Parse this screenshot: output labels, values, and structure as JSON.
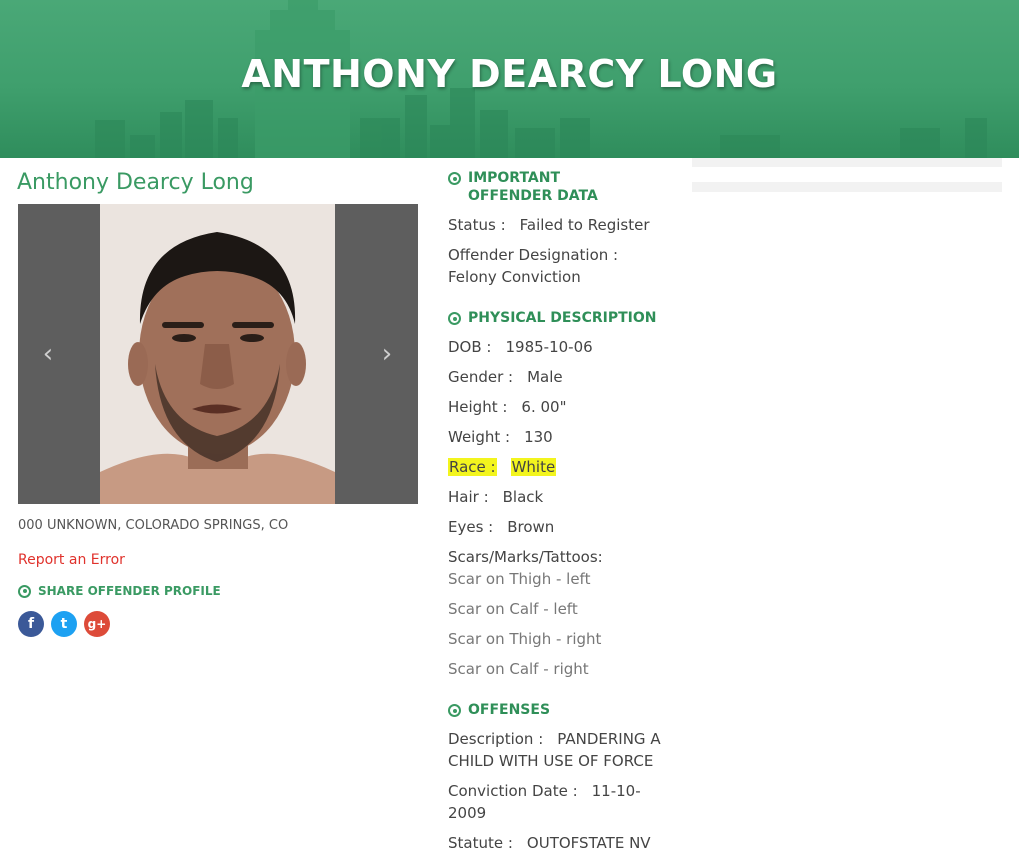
{
  "header": {
    "title": "ANTHONY DEARCY LONG"
  },
  "profile": {
    "name": "Anthony Dearcy Long",
    "address": "000 UNKNOWN, COLORADO SPRINGS, CO",
    "report_link": "Report an Error",
    "share_heading": "SHARE OFFENDER PROFILE",
    "carousel": {
      "prev_icon": "chevron-left-icon",
      "next_icon": "chevron-right-icon"
    },
    "social": [
      {
        "name": "facebook-icon",
        "glyph": "f"
      },
      {
        "name": "twitter-icon",
        "glyph": "t"
      },
      {
        "name": "google-plus-icon",
        "glyph": "g+"
      }
    ]
  },
  "important": {
    "heading": "IMPORTANT OFFENDER DATA",
    "status_label": "Status :",
    "status_value": "Failed to Register",
    "designation_label": "Offender Designation :",
    "designation_value": "Felony Conviction"
  },
  "physical": {
    "heading": "PHYSICAL DESCRIPTION",
    "dob_label": "DOB :",
    "dob_value": "1985-10-06",
    "gender_label": "Gender :",
    "gender_value": "Male",
    "height_label": "Height :",
    "height_value": "6. 00\"",
    "weight_label": "Weight :",
    "weight_value": "130",
    "race_label": "Race :",
    "race_value": "White",
    "hair_label": "Hair :",
    "hair_value": "Black",
    "eyes_label": "Eyes :",
    "eyes_value": "Brown",
    "scars_label": "Scars/Marks/Tattoos:",
    "scars": [
      "Scar on Thigh - left",
      "Scar on Calf - left",
      "Scar on Thigh - right",
      "Scar on Calf - right"
    ]
  },
  "offenses": {
    "heading": "OFFENSES",
    "description_label": "Description :",
    "description_value": "PANDERING A CHILD WITH USE OF FORCE",
    "conviction_label": "Conviction Date :",
    "conviction_value": "11-10-2009",
    "statute_label": "Statute :",
    "statute_value": "OUTOFSTATE NV"
  },
  "colors": {
    "brand_green": "#3a9a63",
    "highlight": "#f3f51e",
    "link_red": "#e0322c"
  }
}
